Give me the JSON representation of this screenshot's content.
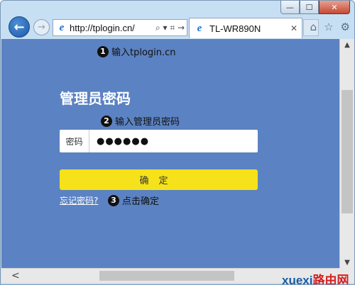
{
  "window": {
    "caption_minimize": "—",
    "caption_maximize": "☐",
    "caption_close": "✕"
  },
  "nav": {
    "back_glyph": "←",
    "forward_glyph": "→",
    "address_url": "http://tplogin.cn/",
    "address_tools": "⌕ ▾ ⌗ →",
    "tab_title": "TL-WR890N",
    "tab_close": "✕",
    "tools": [
      "⌂",
      "☆",
      "⚙"
    ]
  },
  "steps": [
    {
      "num": "1",
      "text": "输入tplogin.cn"
    },
    {
      "num": "2",
      "text": "输入管理员密码"
    },
    {
      "num": "3",
      "text": "点击确定"
    }
  ],
  "login": {
    "title": "管理员密码",
    "password_label": "密码",
    "password_value": "●●●●●●",
    "ok_button": "确定",
    "forgot_link": "忘记密码?"
  },
  "scroll": {
    "up": "▲",
    "down": "▼",
    "left": "<"
  },
  "watermark": {
    "part1": "xuexi",
    "part2": "路由网"
  },
  "colors": {
    "page_bg": "#5b82c2",
    "button_yellow": "#f5e21a",
    "ie_blue": "#1e73d6"
  },
  "icons": [
    "back-arrow-icon",
    "forward-arrow-icon",
    "ie-logo-icon",
    "home-icon",
    "star-icon",
    "gear-icon",
    "close-icon"
  ]
}
